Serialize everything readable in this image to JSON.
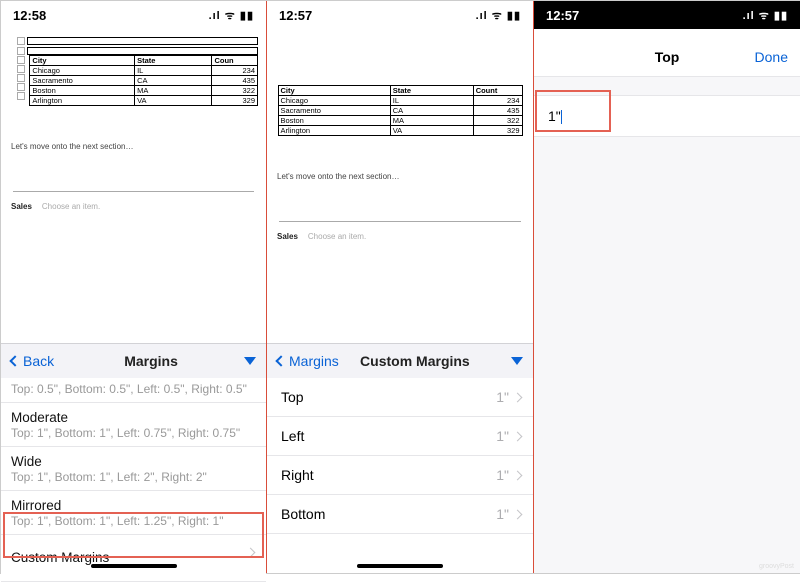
{
  "status": {
    "time1": "12:58",
    "time2": "12:57",
    "time3": "12:57",
    "icons": ".ıl ᯤ ▮▮"
  },
  "doc": {
    "headers": [
      "City",
      "State",
      "Count"
    ],
    "headers_cut": [
      "City",
      "State",
      "Coun"
    ],
    "rows": [
      {
        "city": "Chicago",
        "state": "IL",
        "count": "234"
      },
      {
        "city": "Sacramento",
        "state": "CA",
        "count": "435"
      },
      {
        "city": "Boston",
        "state": "MA",
        "count": "322"
      },
      {
        "city": "Arlington",
        "state": "VA",
        "count": "329"
      }
    ],
    "section_text": "Let's move onto the next section…",
    "sales_label": "Sales",
    "sales_hint": "Choose an item."
  },
  "sheet1": {
    "back": "Back",
    "title": "Margins",
    "cut_desc": "Top: 0.5\", Bottom: 0.5\", Left: 0.5\", Right: 0.5\"",
    "options": [
      {
        "name": "Moderate",
        "desc": "Top: 1\", Bottom: 1\", Left: 0.75\", Right: 0.75\""
      },
      {
        "name": "Wide",
        "desc": "Top: 1\", Bottom: 1\", Left: 2\", Right: 2\""
      },
      {
        "name": "Mirrored",
        "desc": "Top: 1\", Bottom: 1\", Left: 1.25\", Right: 1\""
      }
    ],
    "custom": "Custom Margins"
  },
  "sheet2": {
    "back": "Margins",
    "title": "Custom Margins",
    "items": [
      {
        "label": "Top",
        "value": "1\""
      },
      {
        "label": "Left",
        "value": "1\""
      },
      {
        "label": "Right",
        "value": "1\""
      },
      {
        "label": "Bottom",
        "value": "1\""
      }
    ]
  },
  "sheet3": {
    "title": "Top",
    "done": "Done",
    "value": "1\""
  },
  "watermark": "groovyPost"
}
